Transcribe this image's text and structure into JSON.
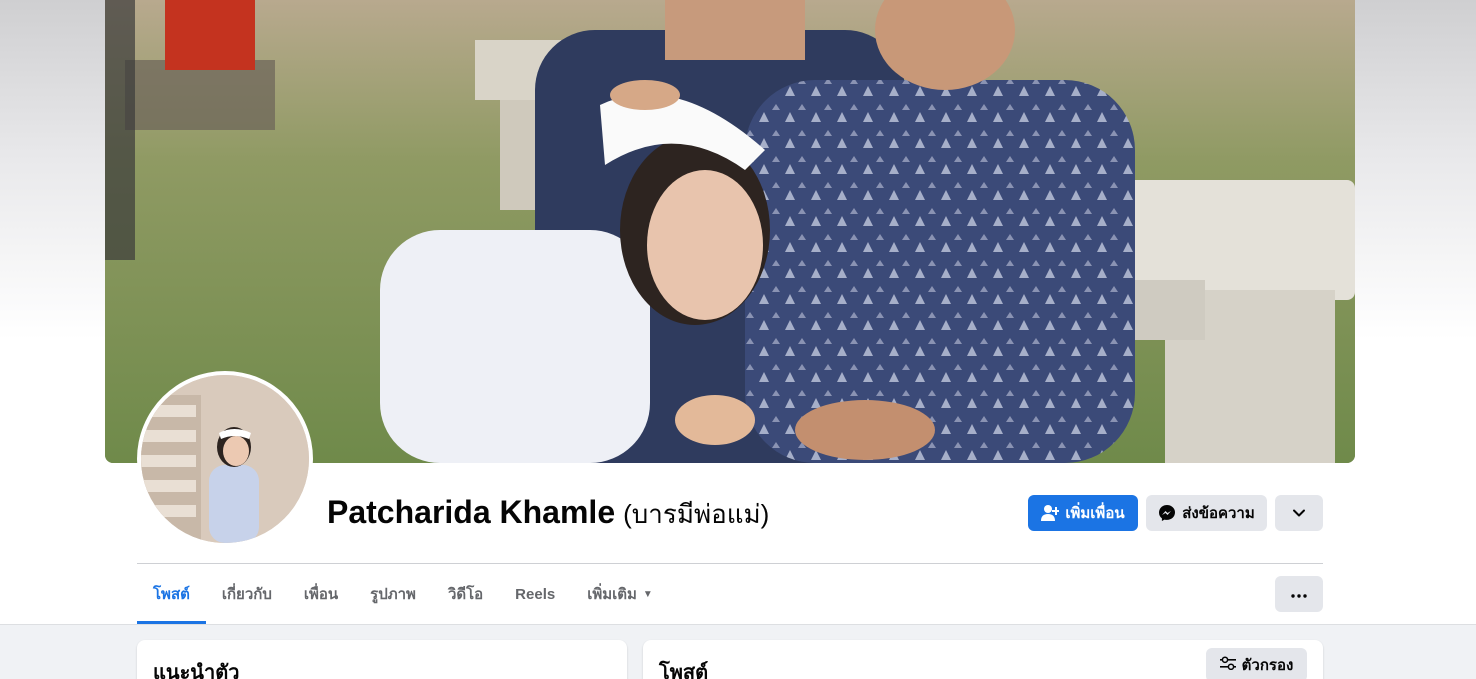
{
  "profile": {
    "name": "Patcharida Khamle",
    "alternate_name": "(บารมีพ่อแม่)"
  },
  "actions": {
    "add_friend_label": "เพิ่มเพื่อน",
    "message_label": "ส่งข้อความ",
    "dropdown_icon": "chevron-down-icon"
  },
  "tabs": [
    {
      "label": "โพสต์",
      "active": true
    },
    {
      "label": "เกี่ยวกับ",
      "active": false
    },
    {
      "label": "เพื่อน",
      "active": false
    },
    {
      "label": "รูปภาพ",
      "active": false
    },
    {
      "label": "วิดีโอ",
      "active": false
    },
    {
      "label": "Reels",
      "active": false
    },
    {
      "label": "เพิ่มเติม",
      "active": false
    }
  ],
  "intro_card": {
    "title": "แนะนำตัว"
  },
  "posts_card": {
    "title": "โพสต์",
    "filter_label": "ตัวกรอง"
  },
  "colors": {
    "accent": "#1b74e4",
    "button_gray": "#e4e6eb",
    "page_bg": "#f0f2f5"
  }
}
